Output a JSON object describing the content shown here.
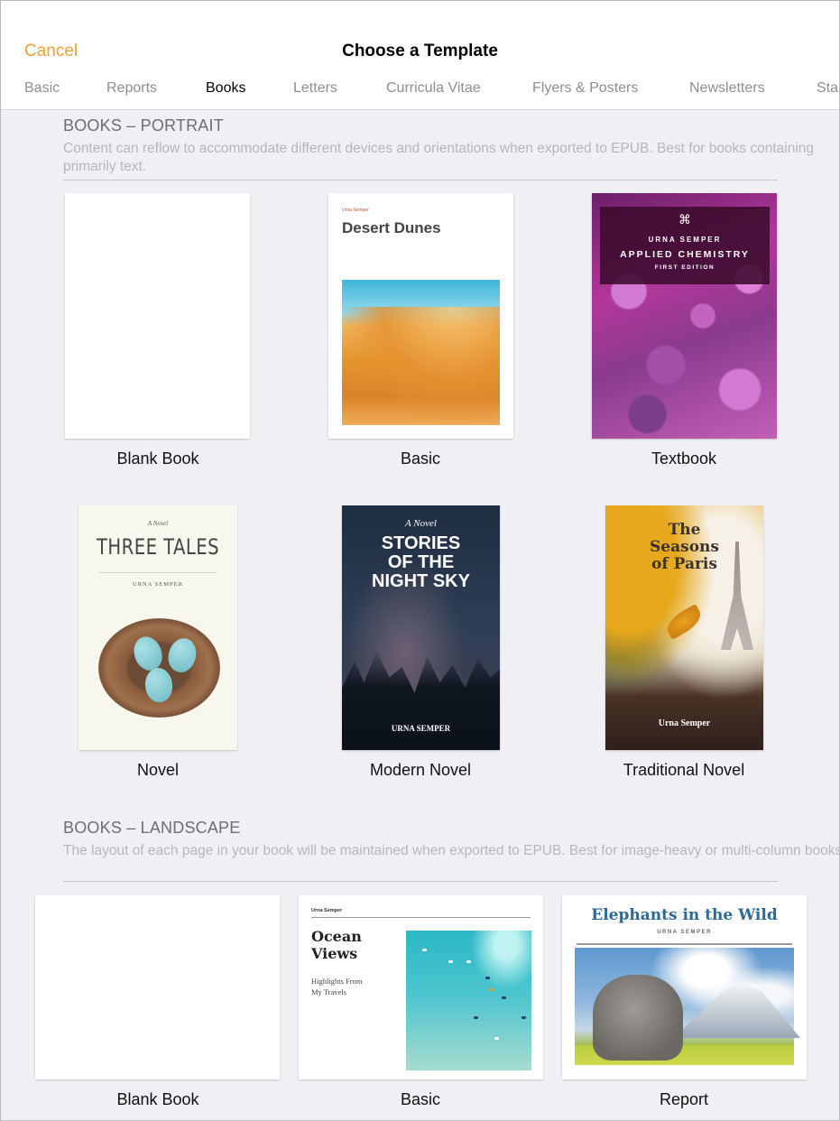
{
  "header": {
    "cancel_label": "Cancel",
    "title": "Choose a Template"
  },
  "tabs": [
    {
      "label": "Basic",
      "active": false
    },
    {
      "label": "Reports",
      "active": false
    },
    {
      "label": "Books",
      "active": true
    },
    {
      "label": "Letters",
      "active": false
    },
    {
      "label": "Curricula Vitae",
      "active": false
    },
    {
      "label": "Flyers & Posters",
      "active": false
    },
    {
      "label": "Newsletters",
      "active": false
    },
    {
      "label": "Sta",
      "active": false
    }
  ],
  "sections": [
    {
      "title": "BOOKS – PORTRAIT",
      "description": "Content can reflow to accommodate different devices and orientations when exported to EPUB. Best for books containing primarily text.",
      "templates": [
        {
          "label": "Blank Book"
        },
        {
          "label": "Basic",
          "cover": {
            "author": "Urna Semper",
            "title": "Desert Dunes"
          }
        },
        {
          "label": "Textbook",
          "cover": {
            "author": "URNA SEMPER",
            "title": "APPLIED CHEMISTRY",
            "edition": "FIRST EDITION",
            "icon": "molecule-icon"
          }
        },
        {
          "label": "Novel",
          "cover": {
            "pretitle": "A Novel",
            "title": "THREE TALES",
            "author": "URNA SEMPER"
          }
        },
        {
          "label": "Modern Novel",
          "cover": {
            "pretitle": "A Novel",
            "title": "STORIES OF THE NIGHT SKY",
            "author": "URNA SEMPER"
          }
        },
        {
          "label": "Traditional Novel",
          "cover": {
            "title": "The Seasons of Paris",
            "author": "Urna Semper"
          }
        }
      ]
    },
    {
      "title": "BOOKS – LANDSCAPE",
      "description": "The layout of each page in your book will be maintained when exported to EPUB. Best for image-heavy or multi-column books.",
      "templates": [
        {
          "label": "Blank Book"
        },
        {
          "label": "Basic",
          "cover": {
            "author": "Urna Semper",
            "title": "Ocean Views",
            "subtitle": "Highlights From My Travels"
          }
        },
        {
          "label": "Report",
          "cover": {
            "title": "Elephants in the Wild",
            "author": "URNA SEMPER"
          }
        }
      ]
    }
  ],
  "colors": {
    "accent": "#f1a033",
    "background": "#efeff4"
  }
}
